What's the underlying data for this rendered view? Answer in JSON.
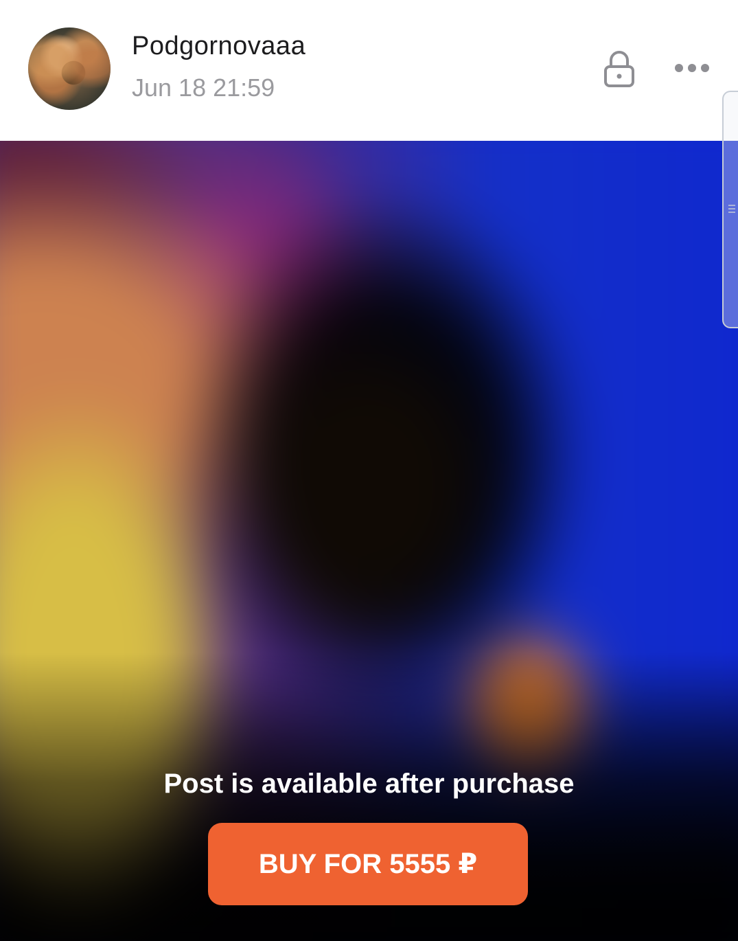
{
  "post": {
    "author": "Podgornovaaa",
    "timestamp": "Jun 18 21:59"
  },
  "header_icons": {
    "lock": "lock-icon",
    "more": "more-horizontal-icon"
  },
  "paywall": {
    "message": "Post is available after purchase",
    "buy_label": "BUY FOR 5555 ₽"
  },
  "colors": {
    "accent": "#ef6231",
    "username": "#1c1c1e",
    "timestamp": "#9a9a9e",
    "icon": "#8e8e93"
  }
}
